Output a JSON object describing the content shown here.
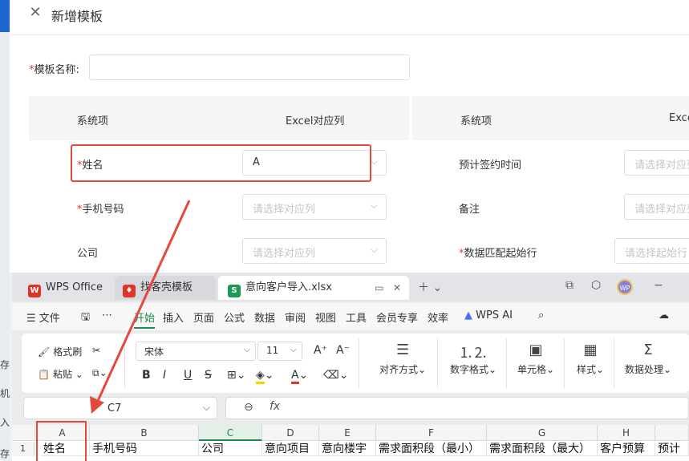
{
  "dialog": {
    "title": "新增模板",
    "template_name_label": "模板名称:",
    "template_name_value": "",
    "table_headers": {
      "left_system": "系统项",
      "left_excel": "Excel对应列",
      "right_system": "系统项",
      "right_excel": "Exce"
    },
    "rows_left": [
      {
        "label": "姓名",
        "required": true,
        "value": "A"
      },
      {
        "label": "手机号码",
        "required": true,
        "placeholder": "请选择对应列"
      },
      {
        "label": "公司",
        "required": false,
        "placeholder": "请选择对应列"
      }
    ],
    "rows_right": [
      {
        "label": "预计签约时间",
        "required": false,
        "placeholder": "请选择对应列"
      },
      {
        "label": "备注",
        "required": false,
        "placeholder": "请选择对应列"
      },
      {
        "label": "数据匹配起始行",
        "required": true,
        "placeholder": "请选择起始行"
      }
    ],
    "required_mark": "*"
  },
  "gutter_chars": [
    "存",
    "机",
    "入",
    "存"
  ],
  "wps": {
    "tabs": {
      "wps_office": "WPS Office",
      "template_tab": "找客壳模板",
      "file_tab": "意向客户导入.xlsx"
    },
    "menu": [
      "文件",
      "开始",
      "插入",
      "页面",
      "公式",
      "数据",
      "审阅",
      "视图",
      "工具",
      "会员专享",
      "效率",
      "WPS AI"
    ],
    "ribbon": {
      "format_painter": "格式刷",
      "paste": "粘贴",
      "font_name": "宋体",
      "font_size": "11",
      "align": "对齐方式",
      "number_format": "数字格式",
      "cell": "单元格",
      "style": "样式",
      "data_processing": "数据处理"
    },
    "cell_ref": "C7",
    "columns": [
      "A",
      "B",
      "C",
      "D",
      "E",
      "F",
      "G",
      "H"
    ],
    "selected_column": "C",
    "row_number": "1",
    "row1": [
      "姓名",
      "手机号码",
      "公司",
      "意向项目",
      "意向楼宇",
      "需求面积段（最小）",
      "需求面积段（最大）",
      "客户预算",
      "预计"
    ]
  },
  "colors": {
    "accent_green": "#1a8a4a",
    "highlight_red": "#e34a3d",
    "required_red": "#e43b3b"
  }
}
